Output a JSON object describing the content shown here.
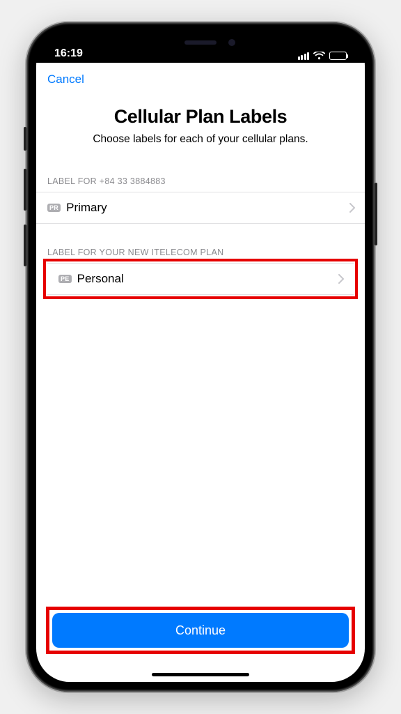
{
  "status": {
    "time": "16:19"
  },
  "nav": {
    "cancel_label": "Cancel"
  },
  "header": {
    "title": "Cellular Plan Labels",
    "subtitle": "Choose labels for each of your cellular plans."
  },
  "sections": {
    "plan1": {
      "header": "LABEL FOR +84 33 3884883",
      "badge": "PR",
      "label": "Primary"
    },
    "plan2": {
      "header": "LABEL FOR YOUR NEW ITelecom PLAN",
      "badge": "PE",
      "label": "Personal"
    }
  },
  "footer": {
    "continue_label": "Continue"
  }
}
